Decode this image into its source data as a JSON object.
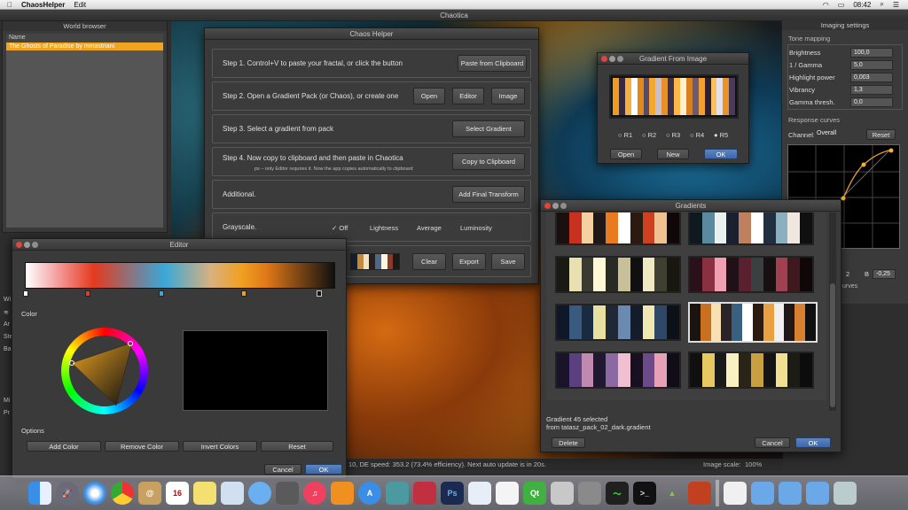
{
  "menubar": {
    "app": "ChaosHelper",
    "edit": "Edit",
    "time": "08:42"
  },
  "chaotica": {
    "title": "Chaotica",
    "status": "10, DE speed: 353.2 (73.4% efficiency). Next auto update is in 20s.",
    "image_scale_label": "Image scale:",
    "image_scale_value": "100%"
  },
  "world_browser": {
    "title": "World browser",
    "col": "Name",
    "item": "The Ghosts of Paradise by mmastriani"
  },
  "imaging": {
    "title": "Imaging settings",
    "tone": "Tone mapping",
    "brightness": "Brightness",
    "brightness_v": "100,0",
    "gamma": "1 / Gamma",
    "gamma_v": "5,0",
    "highlight": "Highlight power",
    "highlight_v": "0,003",
    "vibrancy": "Vibrancy",
    "vibrancy_v": "1,3",
    "gthresh": "Gamma thresh.",
    "gthresh_v": "0,0",
    "curves": "Response curves",
    "channel": "Channel:",
    "channel_v": "Overall",
    "reset": "Reset",
    "b_label": "B",
    "b_val": "-0,25",
    "b_left": "2",
    "curves_tail": "urves"
  },
  "helper": {
    "title": "Chaos Helper",
    "step1": "Step 1.    Control+V to paste your fractal, or click the button",
    "step1_btn": "Paste from Clipboard",
    "step2": "Step 2.    Open a Gradient Pack (or Chaos), or create one",
    "open": "Open",
    "editor": "Editor",
    "image": "Image",
    "step3": "Step 3.    Select a gradient from pack",
    "select": "Select Gradient",
    "step4": "Step 4.    Now copy to clipboard and then paste in Chaotica",
    "step4_note": "ps – only Editor requires it. Now the app copies automatically to clipboard",
    "copy": "Copy to Clipboard",
    "additional": "Additional.",
    "addft": "Add Final Transform",
    "gray": "Grayscale.",
    "off": "✓ Off",
    "lightness": "Lightness",
    "average": "Average",
    "luminosity": "Luminosity",
    "clear": "Clear",
    "export": "Export",
    "save": "Save"
  },
  "gfi": {
    "title": "Gradient From Image",
    "r1": "R1",
    "r2": "R2",
    "r3": "R3",
    "r4": "R4",
    "r5": "R5",
    "open": "Open",
    "new": "New",
    "ok": "OK"
  },
  "gradients": {
    "title": "Gradients",
    "sel1": "Gradient 45 selected",
    "sel2": "from tatasz_pack_02_dark.gradient",
    "delete": "Delete",
    "cancel": "Cancel",
    "ok": "OK"
  },
  "editor": {
    "title": "Editor",
    "color": "Color",
    "options": "Options",
    "add": "Add Color",
    "remove": "Remove Color",
    "invert": "Invert Colors",
    "reset": "Reset",
    "cancel": "Cancel",
    "ok": "OK"
  },
  "left_fragments": [
    "Wi",
    "≋",
    "Ar",
    "Ste",
    "Ba",
    "Mi",
    "Pr"
  ],
  "dock": [
    "Finder",
    "Launchpad",
    "Safari",
    "Chrome",
    "Contacts",
    "Calendar",
    "Notes",
    "Preview",
    "Messages",
    "FaceTime",
    "iTunes",
    "iBooks",
    "App Store",
    "Network",
    "Steam",
    "Ps",
    "TextEdit",
    "Files",
    "Qt",
    "Calculator",
    "System Preferences",
    "Activity Monitor",
    "Terminal",
    "Android",
    "Stickies",
    "Downloads",
    "Documents",
    "Folder",
    "Trash"
  ]
}
